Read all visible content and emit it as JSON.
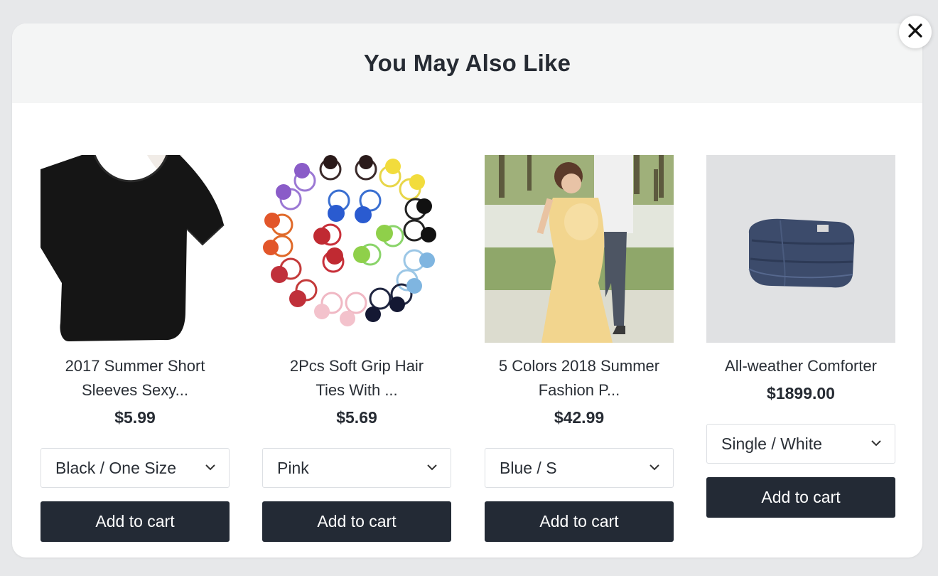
{
  "modal": {
    "title": "You May Also Like",
    "close_icon": "close-icon",
    "colors": {
      "button": "#232a35",
      "header": "#f4f5f5"
    }
  },
  "products": [
    {
      "name_line1": "2017 Summer Short",
      "name_line2": "Sleeves Sexy...",
      "price": "$5.99",
      "variant": "Black / One Size",
      "cart_label": "Add to cart",
      "image": "black-crop-top"
    },
    {
      "name_line1": "2Pcs Soft Grip Hair",
      "name_line2": "Ties With ...",
      "price": "$5.69",
      "variant": "Pink",
      "cart_label": "Add to cart",
      "image": "pom-pom-hair-ties"
    },
    {
      "name_line1": "5 Colors 2018 Summer",
      "name_line2": "Fashion P...",
      "price": "$42.99",
      "variant": "Blue / S",
      "cart_label": "Add to cart",
      "image": "maternity-dress-photo"
    },
    {
      "name_line1": "All-weather Comforter",
      "price": "$1899.00",
      "variant": "Single / White",
      "cart_label": "Add to cart",
      "image": "folded-comforter"
    }
  ]
}
